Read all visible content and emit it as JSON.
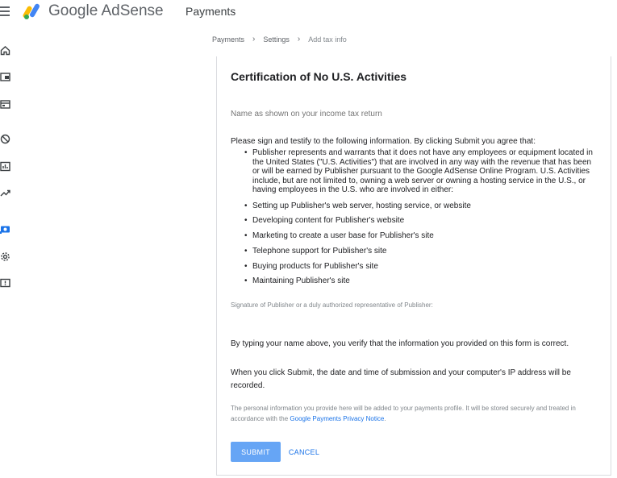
{
  "app": {
    "brand": "Google AdSense",
    "page_title": "Payments"
  },
  "rail": {
    "items": [
      "home-icon",
      "sites-icon",
      "ads-icon",
      "blocking-controls-icon",
      "reports-icon",
      "optimization-icon",
      "payments-icon",
      "settings-icon",
      "policy-center-icon"
    ],
    "active": "payments-icon"
  },
  "breadcrumb": {
    "items": [
      "Payments",
      "Settings"
    ],
    "current": "Add tax info"
  },
  "form": {
    "title": "Certification of No U.S. Activities",
    "name_placeholder": "Name as shown on your income tax return",
    "intro": "Please sign and testify to the following information. By clicking Submit you agree that:",
    "representation": "Publisher represents and warrants that it does not have any employees or equipment located in the United States (\"U.S. Activities\") that are involved in any way with the revenue that has been or will be earned by Publisher pursuant to the Google AdSense Online Program. U.S. Activities include, but are not limited to, owning a web server or owning a hosting service in the U.S., or having employees in the U.S. who are involved in either:",
    "activities": [
      "Setting up Publisher's web server, hosting service, or website",
      "Developing content for Publisher's website",
      "Marketing to create a user base for Publisher's site",
      "Telephone support for Publisher's site",
      "Buying products for Publisher's site",
      "Maintaining Publisher's site"
    ],
    "signature_label": "Signature of Publisher or a duly authorized representative of Publisher:",
    "verify_text": "By typing your name above, you verify that the information you provided on this form is correct.",
    "submit_note": "When you click Submit, the date and time of submission and your computer's IP address will be recorded.",
    "privacy_text": "The personal information you provide here will be added to your payments profile. It will be stored securely and treated in accordance with the",
    "privacy_link": "Google Payments Privacy Notice",
    "privacy_end": ".",
    "submit_label": "SUBMIT",
    "cancel_label": "CANCEL"
  },
  "colors": {
    "primary": "#1a73e8",
    "submit_disabled": "#66a5f5",
    "text": "#202124",
    "muted": "#80868b",
    "logo_yellow": "#fbbc04",
    "logo_blue": "#4285f4",
    "logo_green": "#34a853"
  }
}
